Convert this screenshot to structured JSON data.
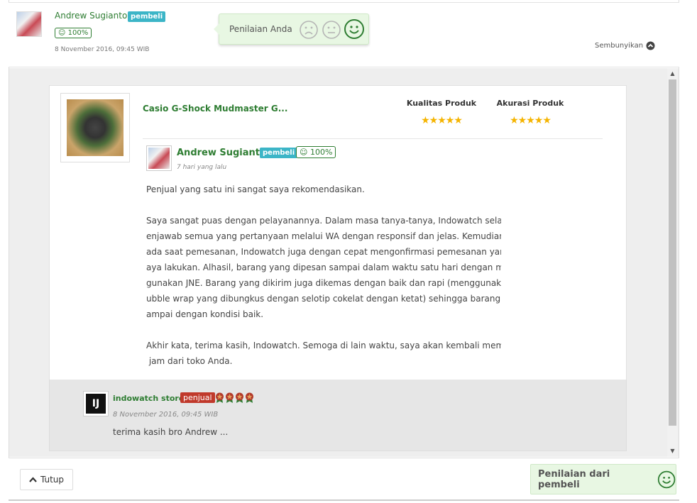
{
  "header": {
    "reviewer_name": "Andrew Sugianto",
    "reviewer_badge": "pembeli",
    "reviewer_percent": "100%",
    "review_date": "8 November 2016, 09:45 WIB",
    "rating_label": "Penilaian Anda",
    "hide_label": "Sembunyikan"
  },
  "product": {
    "name": "Casio G-Shock Mudmaster G...",
    "quality_label": "Kualitas Produk",
    "quality_stars": 5,
    "accuracy_label": "Akurasi Produk",
    "accuracy_stars": 5
  },
  "review": {
    "name": "Andrew Sugianto",
    "badge": "pembeli",
    "percent": "100%",
    "date": "7 hari yang lalu",
    "paragraphs": [
      [
        "Penjual yang satu ini sangat saya rekomendasikan."
      ],
      [
        "Saya sangat puas dengan pelayanannya. Dalam masa tanya-tanya, Indowatch selalu m",
        "enjawab semua yang pertanyaan melalui WA dengan responsif dan jelas. Kemudian, p",
        "ada saat pemesanan, Indowatch juga dengan cepat mengonfirmasi pemesanan yang s",
        "aya lakukan. Alhasil, barang yang dipesan sampai dalam waktu satu hari dengan meng",
        "gunakan JNE. Barang yang dikirim juga dikemas dengan baik dan rapi (menggunakan b",
        "ubble wrap yang dibungkus dengan selotip cokelat dengan ketat) sehingga barangnya s",
        "ampai dengan kondisi baik."
      ],
      [
        "Akhir kata, terima kasih, Indowatch. Semoga di lain waktu, saya akan kembali membeli",
        " jam dari toko Anda."
      ]
    ]
  },
  "reply": {
    "store_name": "indowatch store",
    "badge": "penjual",
    "date": "8 November 2016, 09:45 WIB",
    "text": "terima kasih bro Andrew ...",
    "medal_count": 4
  },
  "footer": {
    "close_label": "Tutup",
    "buyer_rating_label": "Penilaian dari pembeli"
  },
  "colors": {
    "green": "#2e7d32",
    "buyer_badge": "#3cb5c7",
    "seller_badge": "#c0392b",
    "star": "#f5b400",
    "rating_bg": "#e8f7e3"
  }
}
